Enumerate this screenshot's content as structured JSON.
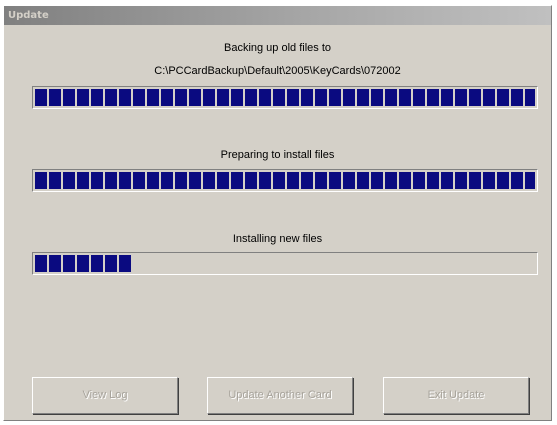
{
  "window": {
    "title": "Update"
  },
  "steps": [
    {
      "label": "Backing up old files to",
      "path": "C:\\PCCardBackup\\Default\\2005\\KeyCards\\072002",
      "progress_percent": 100
    },
    {
      "label": "Preparing to install files",
      "progress_percent": 100
    },
    {
      "label": "Installing new files",
      "progress_percent": 20
    }
  ],
  "buttons": {
    "view_log": "View Log",
    "update_another": "Update Another Card",
    "exit": "Exit Update"
  },
  "colors": {
    "progress_fill": "#0a0a80",
    "window_face": "#d4d0c8",
    "disabled_text": "#a7a39b"
  }
}
